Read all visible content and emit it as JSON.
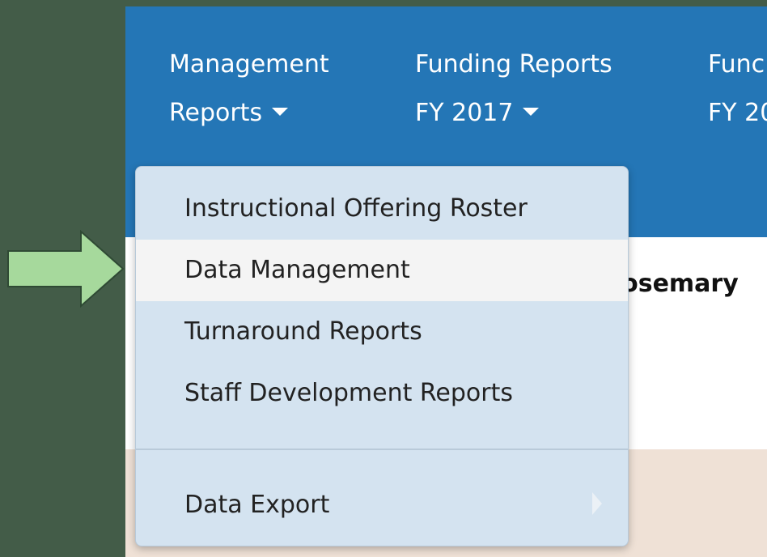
{
  "navbar": {
    "items": [
      {
        "line1": "Management",
        "line2": "Reports"
      },
      {
        "line1": "Funding Reports",
        "line2": "FY 2017"
      },
      {
        "line1": "Func",
        "line2": "FY 20"
      }
    ]
  },
  "content": {
    "name": "Rosemary",
    "paren": ")"
  },
  "dropdown": {
    "items": [
      {
        "label": "Instructional Offering Roster"
      },
      {
        "label": "Data Management"
      },
      {
        "label": "Turnaround Reports"
      },
      {
        "label": "Staff Development Reports"
      },
      {
        "label": "Data Export"
      }
    ]
  },
  "colors": {
    "background": "#435c48",
    "navbar": "#2476b6",
    "dropdown": "#d4e3f0",
    "highlight": "#f4f4f4",
    "arrow": "#a6d99c",
    "page_lower": "#efe1d6"
  },
  "icons": [
    "caret-down-icon",
    "submenu-arrow-icon",
    "pointer-arrow-icon"
  ]
}
